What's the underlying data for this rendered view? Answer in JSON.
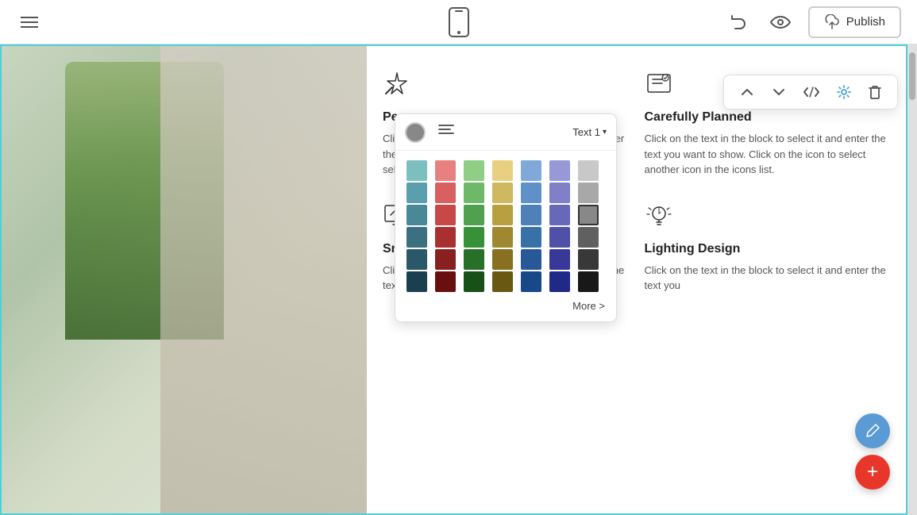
{
  "topbar": {
    "hamburger_label": "menu",
    "publish_label": "Publish",
    "undo_label": "undo",
    "preview_label": "preview"
  },
  "toolbar": {
    "move_up_label": "↑",
    "move_down_label": "↓",
    "code_label": "</>",
    "settings_label": "⚙",
    "delete_label": "🗑"
  },
  "text_style_bar": {
    "text_selector_label": "Text 1",
    "dropdown_indicator": "▾",
    "color_label": "color",
    "align_label": "align"
  },
  "color_palette": {
    "more_label": "More >",
    "colors": [
      [
        "#7bbfbe",
        "#e88080",
        "#8fce84",
        "#e8d080",
        "#80a8d8",
        "#9898d8",
        "#c8c8c8"
      ],
      [
        "#5a9fae",
        "#d86060",
        "#6fb86a",
        "#d0b860",
        "#6090c8",
        "#8080c8",
        "#a8a8a8"
      ],
      [
        "#4a8898",
        "#c84848",
        "#50a050",
        "#b8a040",
        "#5080b8",
        "#6868b8",
        "#888888"
      ],
      [
        "#3a7080",
        "#a83030",
        "#389038",
        "#a08830",
        "#3870a8",
        "#5050a8",
        "#606060"
      ],
      [
        "#2a5868",
        "#882020",
        "#287028",
        "#887020",
        "#285898",
        "#383898",
        "#383838"
      ],
      [
        "#1a4050",
        "#681010",
        "#185018",
        "#685810",
        "#184888",
        "#202888",
        "#181818"
      ]
    ]
  },
  "features": [
    {
      "icon": "✦",
      "title": "Pe...",
      "desc": "Click on the text in the block to select it and 7e... nter the text you want to show. C... Click on the icon to select anothe... her icon in the icons list."
    },
    {
      "icon": "🖼",
      "title": "Carefully Planned",
      "desc": "Click on the text in the block to select it and enter the text you want to show. Click on the icon to select another icon in the icons list."
    },
    {
      "icon": "🖥",
      "title": "Smartly Execute",
      "desc": "Click on the text in the block to select it and enter the text you"
    },
    {
      "icon": "💡",
      "title": "Lighting Design",
      "desc": "Click on the text in the block to select it and enter the text you"
    }
  ],
  "fab": {
    "edit_icon": "✎",
    "add_icon": "+"
  }
}
